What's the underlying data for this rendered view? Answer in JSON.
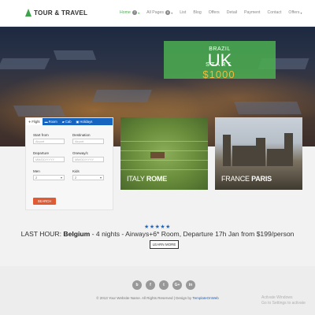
{
  "nav": {
    "logo": "TOUR & TRAVEL",
    "items": [
      {
        "label": "Home",
        "badge": "7",
        "caret": "▾",
        "active": true
      },
      {
        "label": "All Pages",
        "badge": "8",
        "caret": "▾"
      },
      {
        "label": "List"
      },
      {
        "label": "Blog"
      },
      {
        "label": "Offers"
      },
      {
        "label": "Detail"
      },
      {
        "label": "Payment"
      },
      {
        "label": "Contact"
      },
      {
        "label": "Offers",
        "caret": "▾"
      }
    ]
  },
  "hero": {
    "country": "BRAZIL",
    "city": "UK",
    "start_label": "START",
    "price": "$1000"
  },
  "booking": {
    "tabs": [
      "Flight",
      "Room",
      "Cab",
      "Holidays"
    ],
    "start_from_label": "Start from",
    "start_from_placeholder": "Airport",
    "destination_label": "Destination",
    "destination_placeholder": "Airport",
    "departure_label": "Departure",
    "departure_placeholder": "MM/DD/YYYY",
    "oneway_label": "Oneway/c",
    "oneway_placeholder": "MM/DD/YYYY",
    "men_label": "Men",
    "men_value": "2",
    "kids_label": "Kids",
    "kids_value": "2",
    "search_button": "SEARCH"
  },
  "destinations": [
    {
      "country": "ITALY",
      "city": "ROME"
    },
    {
      "country": "FRANCE",
      "city": "PARIS"
    }
  ],
  "deal": {
    "stars": "★★★★★",
    "prefix": "LAST HOUR: ",
    "place": "Belgium",
    "rest": " - 4 nights - Airways+6* Room, Departure 17h Jan from $199/person",
    "button": "LEARN MORE"
  },
  "footer": {
    "socials": [
      "b",
      "f",
      "t",
      "G+",
      "in"
    ],
    "copyright_text": "© 2013 Your Website Name. All Rights Reserved | Design by ",
    "copyright_link": "TemplateOnWeb",
    "watermark_line1": "Activate Windows",
    "watermark_line2": "Go to Settings to activate"
  },
  "colors": {
    "accent_green": "#4caf50",
    "tab_blue": "#1565c0",
    "search_orange": "#e05a33",
    "price_gold": "#f6b93b",
    "star_blue": "#1a66c7"
  }
}
